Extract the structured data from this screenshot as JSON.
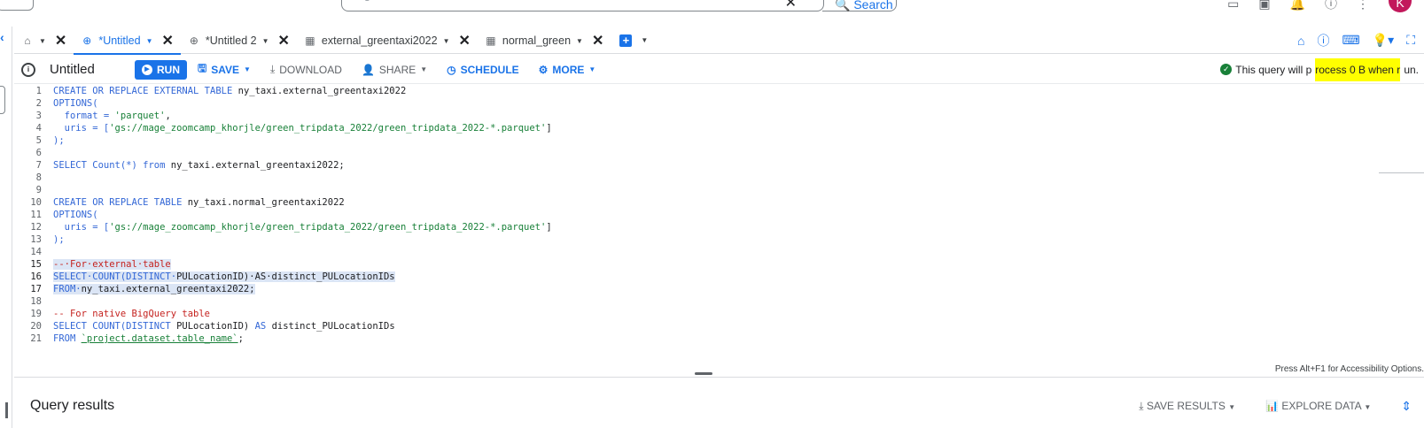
{
  "topbar": {
    "search_placeholder": "Big",
    "search_button": "Search",
    "avatar_letter": "K"
  },
  "tabs": [
    {
      "label": "",
      "icon": "home-icon"
    },
    {
      "label": "*Untitled",
      "icon": "query-icon",
      "active": true
    },
    {
      "label": "*Untitled 2",
      "icon": "query-icon"
    },
    {
      "label": "external_greentaxi2022",
      "icon": "table-icon"
    },
    {
      "label": "normal_green",
      "icon": "table-icon"
    }
  ],
  "toolbar": {
    "title": "Untitled",
    "run": "RUN",
    "save": "SAVE",
    "download": "DOWNLOAD",
    "share": "SHARE",
    "schedule": "SCHEDULE",
    "more": "MORE",
    "validator_prefix": "This query will p",
    "validator_highlight": "rocess 0 B when r",
    "validator_suffix": "un."
  },
  "editor": {
    "lines": [
      "1",
      "2",
      "3",
      "4",
      "5",
      "6",
      "7",
      "8",
      "9",
      "10",
      "11",
      "12",
      "13",
      "14",
      "15",
      "16",
      "17",
      "18",
      "19",
      "20",
      "21"
    ],
    "l1a": "CREATE OR REPLACE EXTERNAL TABLE ",
    "l1b": "ny_taxi.external_greentaxi2022",
    "l2": "OPTIONS(",
    "l3a": "  format = ",
    "l3b": "'parquet'",
    "l3c": ",",
    "l4a": "  uris = [",
    "l4b": "'gs://mage_zoomcamp_khorjle/green_tripdata_2022/green_tripdata_2022-*.parquet'",
    "l4c": "]",
    "l5": ");",
    "l7a": "SELECT Count(*) from ",
    "l7b": "ny_taxi.external_greentaxi2022;",
    "l10a": "CREATE OR REPLACE TABLE ",
    "l10b": "ny_taxi.normal_greentaxi2022",
    "l11": "OPTIONS(",
    "l12a": "  uris = [",
    "l12b": "'gs://mage_zoomcamp_khorjle/green_tripdata_2022/green_tripdata_2022-*.parquet'",
    "l12c": "]",
    "l13": ");",
    "l15": "--·For·external·table",
    "l16a": "SELECT·COUNT(DISTINCT·",
    "l16b": "PULocationID)·AS·",
    "l16c": "distinct_PULocationIDs",
    "l17a": "FROM·",
    "l17b": "ny_taxi.external_greentaxi2022;",
    "l19": "-- For native BigQuery table",
    "l20a": "SELECT COUNT(DISTINCT ",
    "l20b": "PULocationID) ",
    "l20c": "AS ",
    "l20d": "distinct_PULocationIDs",
    "l21a": "FROM ",
    "l21b": "`project.dataset.table_name`",
    "l21c": ";"
  },
  "a11y_hint": "Press Alt+F1 for Accessibility Options.",
  "results": {
    "title": "Query results",
    "save_results": "SAVE RESULTS",
    "explore_data": "EXPLORE DATA"
  }
}
